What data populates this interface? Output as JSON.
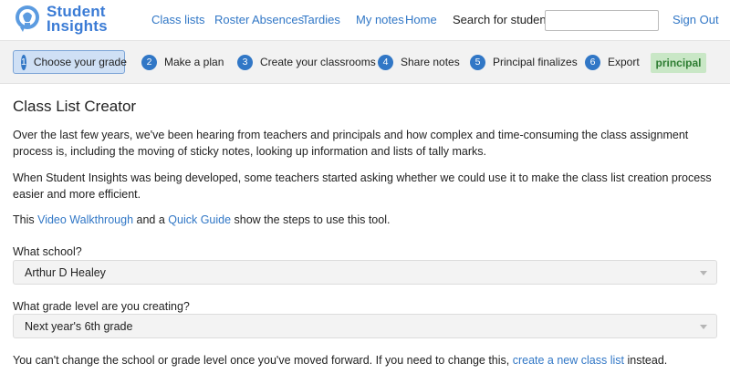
{
  "app": {
    "logo_line1": "Student",
    "logo_line2": "Insights"
  },
  "nav": {
    "class_lists": "Class lists",
    "roster": "Roster",
    "absences": "Absences",
    "tardies": "Tardies",
    "my_notes": "My notes",
    "home": "Home",
    "search_label": "Search for student:",
    "search_value": "",
    "sign_out": "Sign Out"
  },
  "steps": [
    {
      "number": "1",
      "label": "Choose your grade",
      "active": true
    },
    {
      "number": "2",
      "label": "Make a plan"
    },
    {
      "number": "3",
      "label": "Create your classrooms"
    },
    {
      "number": "4",
      "label": "Share notes"
    },
    {
      "number": "5",
      "label": "Principal finalizes"
    },
    {
      "number": "6",
      "label": "Export"
    }
  ],
  "role_badge": "principal",
  "colors": {
    "link": "#3177c6",
    "active_step_bg": "#cfe0f5",
    "badge_bg": "#c9e7c6",
    "badge_text": "#2e7d32"
  },
  "main": {
    "title": "Class List Creator",
    "para1": "Over the last few years, we've been hearing from teachers and principals and how complex and time-consuming the class assignment process is, including the moving of sticky notes, looking up information and lists of tally marks.",
    "para2": "When Student Insights was being developed, some teachers started asking whether we could use it to make the class list creation process easier and more efficient.",
    "para3_prefix": "This ",
    "video_link": "Video Walkthrough",
    "para3_mid": " and a ",
    "guide_link": "Quick Guide",
    "para3_suffix": " show the steps to use this tool.",
    "school_label": "What school?",
    "school_value": "Arthur D Healey",
    "grade_label": "What grade level are you creating?",
    "grade_value": "Next year's 6th grade",
    "footer_prefix": "You can't change the school or grade level once you've moved forward. If you need to change this, ",
    "footer_link": "create a new class list",
    "footer_suffix": " instead."
  }
}
